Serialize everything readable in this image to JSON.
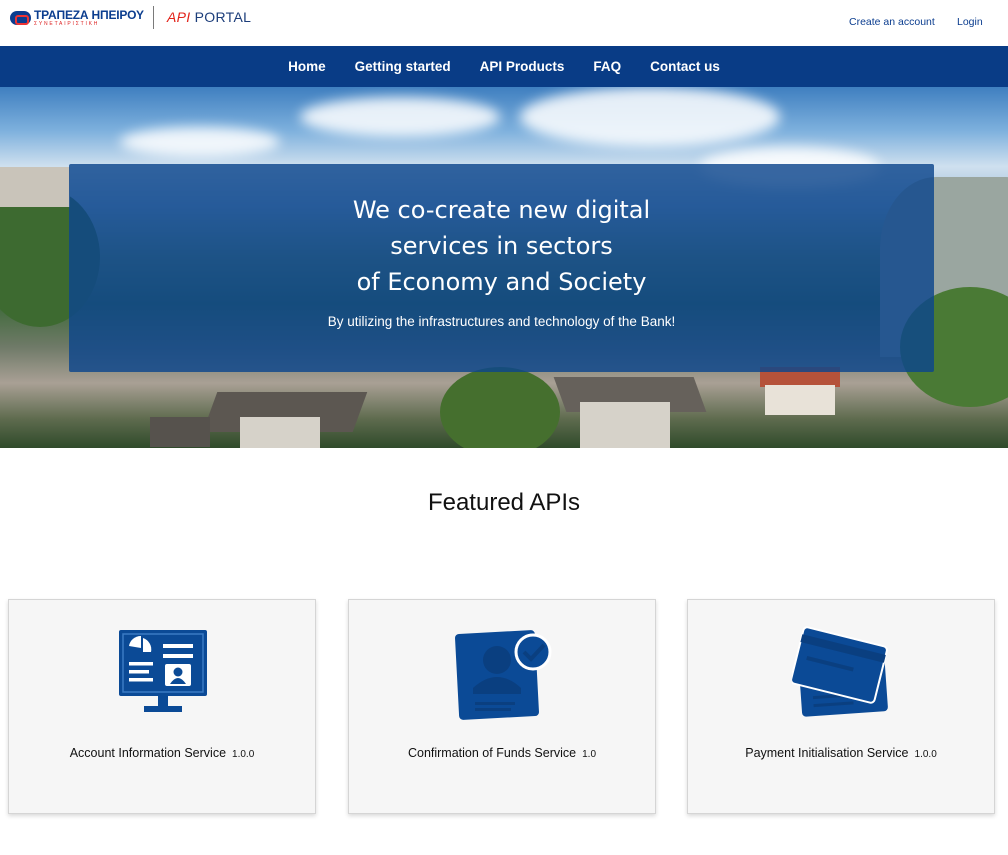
{
  "header": {
    "bank_name": "ΤΡΑΠΕΖΑ ΗΠΕΙΡΟΥ",
    "bank_sub": "ΣΥΝΕΤΑΙΡΙΣΤΙΚΗ",
    "portal_api": "API",
    "portal_name": " PORTAL",
    "create_account": "Create an account",
    "login": "Login"
  },
  "nav": {
    "items": [
      "Home",
      "Getting started",
      "API Products",
      "FAQ",
      "Contact us"
    ]
  },
  "hero": {
    "title_line1": "We co-create new digital",
    "title_line2": "services in sectors",
    "title_line3": "of Economy and Society",
    "subtitle": "By utilizing the infrastructures and technology of the Bank!"
  },
  "featured": {
    "title": "Featured APIs",
    "cards": [
      {
        "name": "Account Information Service",
        "version": "1.0.0",
        "icon": "monitor-profile-icon"
      },
      {
        "name": "Confirmation of Funds Service",
        "version": "1.0",
        "icon": "verified-user-card-icon"
      },
      {
        "name": "Payment Initialisation Service",
        "version": "1.0.0",
        "icon": "credit-cards-icon"
      }
    ]
  },
  "colors": {
    "brand_blue": "#093c86",
    "accent_red": "#e2231a",
    "icon_blue": "#0b4a96"
  }
}
